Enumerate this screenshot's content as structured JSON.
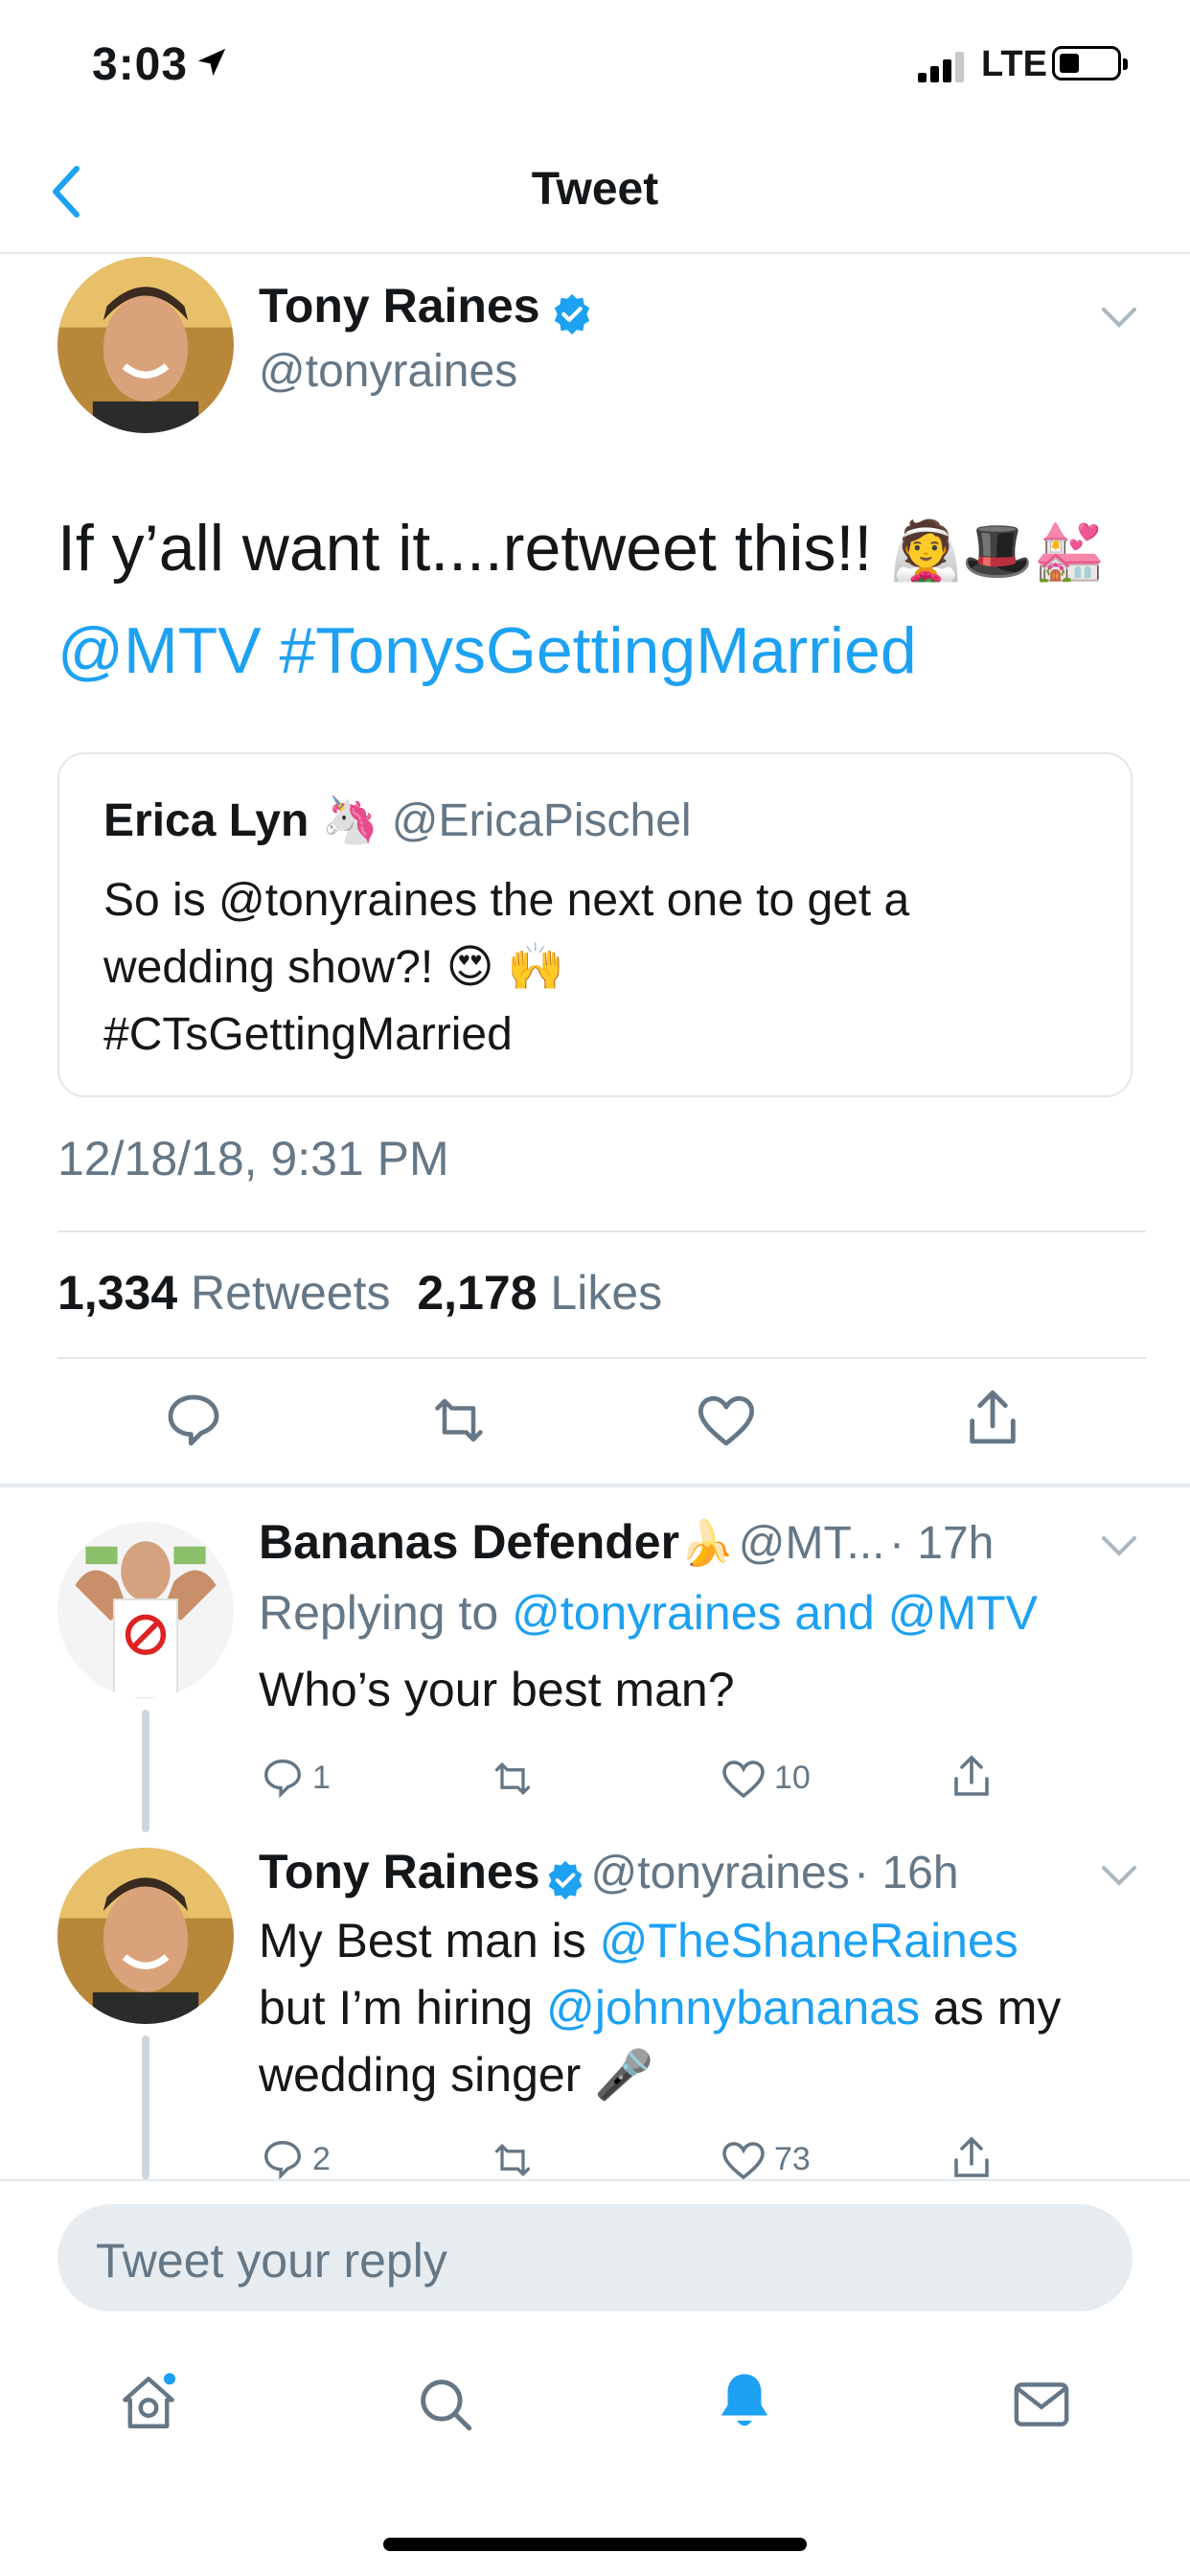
{
  "status_bar": {
    "time": "3:03",
    "network": "LTE"
  },
  "nav": {
    "title": "Tweet"
  },
  "tweet": {
    "author_name": "Tony Raines",
    "author_handle": "@tonyraines",
    "text_plain": "If y’all want it....retweet this!!",
    "text_emoji": "👰🎩💒",
    "text_mention": "@MTV",
    "text_hashtag": "#TonysGettingMarried",
    "quote": {
      "author_name": "Erica Lyn",
      "author_emoji": "🦄",
      "author_handle": "@EricaPischel",
      "line1": "So is @tonyraines the next one to get a",
      "line2_text": "wedding show?!",
      "line2_emoji": "😍 🙌",
      "line3": "#CTsGettingMarried"
    },
    "timestamp": "12/18/18, 9:31 PM",
    "retweets_count": "1,334",
    "retweets_label": "Retweets",
    "likes_count": "2,178",
    "likes_label": "Likes"
  },
  "replies": [
    {
      "author_name": "Bananas Defender",
      "author_emoji": "🍌",
      "author_handle": "@MT...",
      "time": "· 17h",
      "replying_prefix": "Replying to",
      "replying_to": "@tonyraines and @MTV",
      "text": "Who’s your best man?",
      "reply_count": "1",
      "like_count": "10"
    },
    {
      "author_name": "Tony Raines",
      "author_handle": "@tonyraines",
      "time": "· 16h",
      "text_a": "My Best man is",
      "mention_a": "@TheShaneRaines",
      "text_b": "but I’m hiring",
      "mention_b": "@johnnybananas",
      "text_c": "as my",
      "text_d": "wedding singer",
      "text_emoji": "🎤",
      "reply_count": "2",
      "like_count": "73"
    }
  ],
  "composer": {
    "placeholder": "Tweet your reply"
  },
  "tabbar": {
    "icons": [
      "home-icon",
      "search-icon",
      "notifications-icon",
      "messages-icon"
    ],
    "active": "notifications",
    "accent": "#1da1f2"
  },
  "colors": {
    "accent": "#1da1f2",
    "secondary_text": "#657786",
    "divider": "#e1e8ed"
  }
}
